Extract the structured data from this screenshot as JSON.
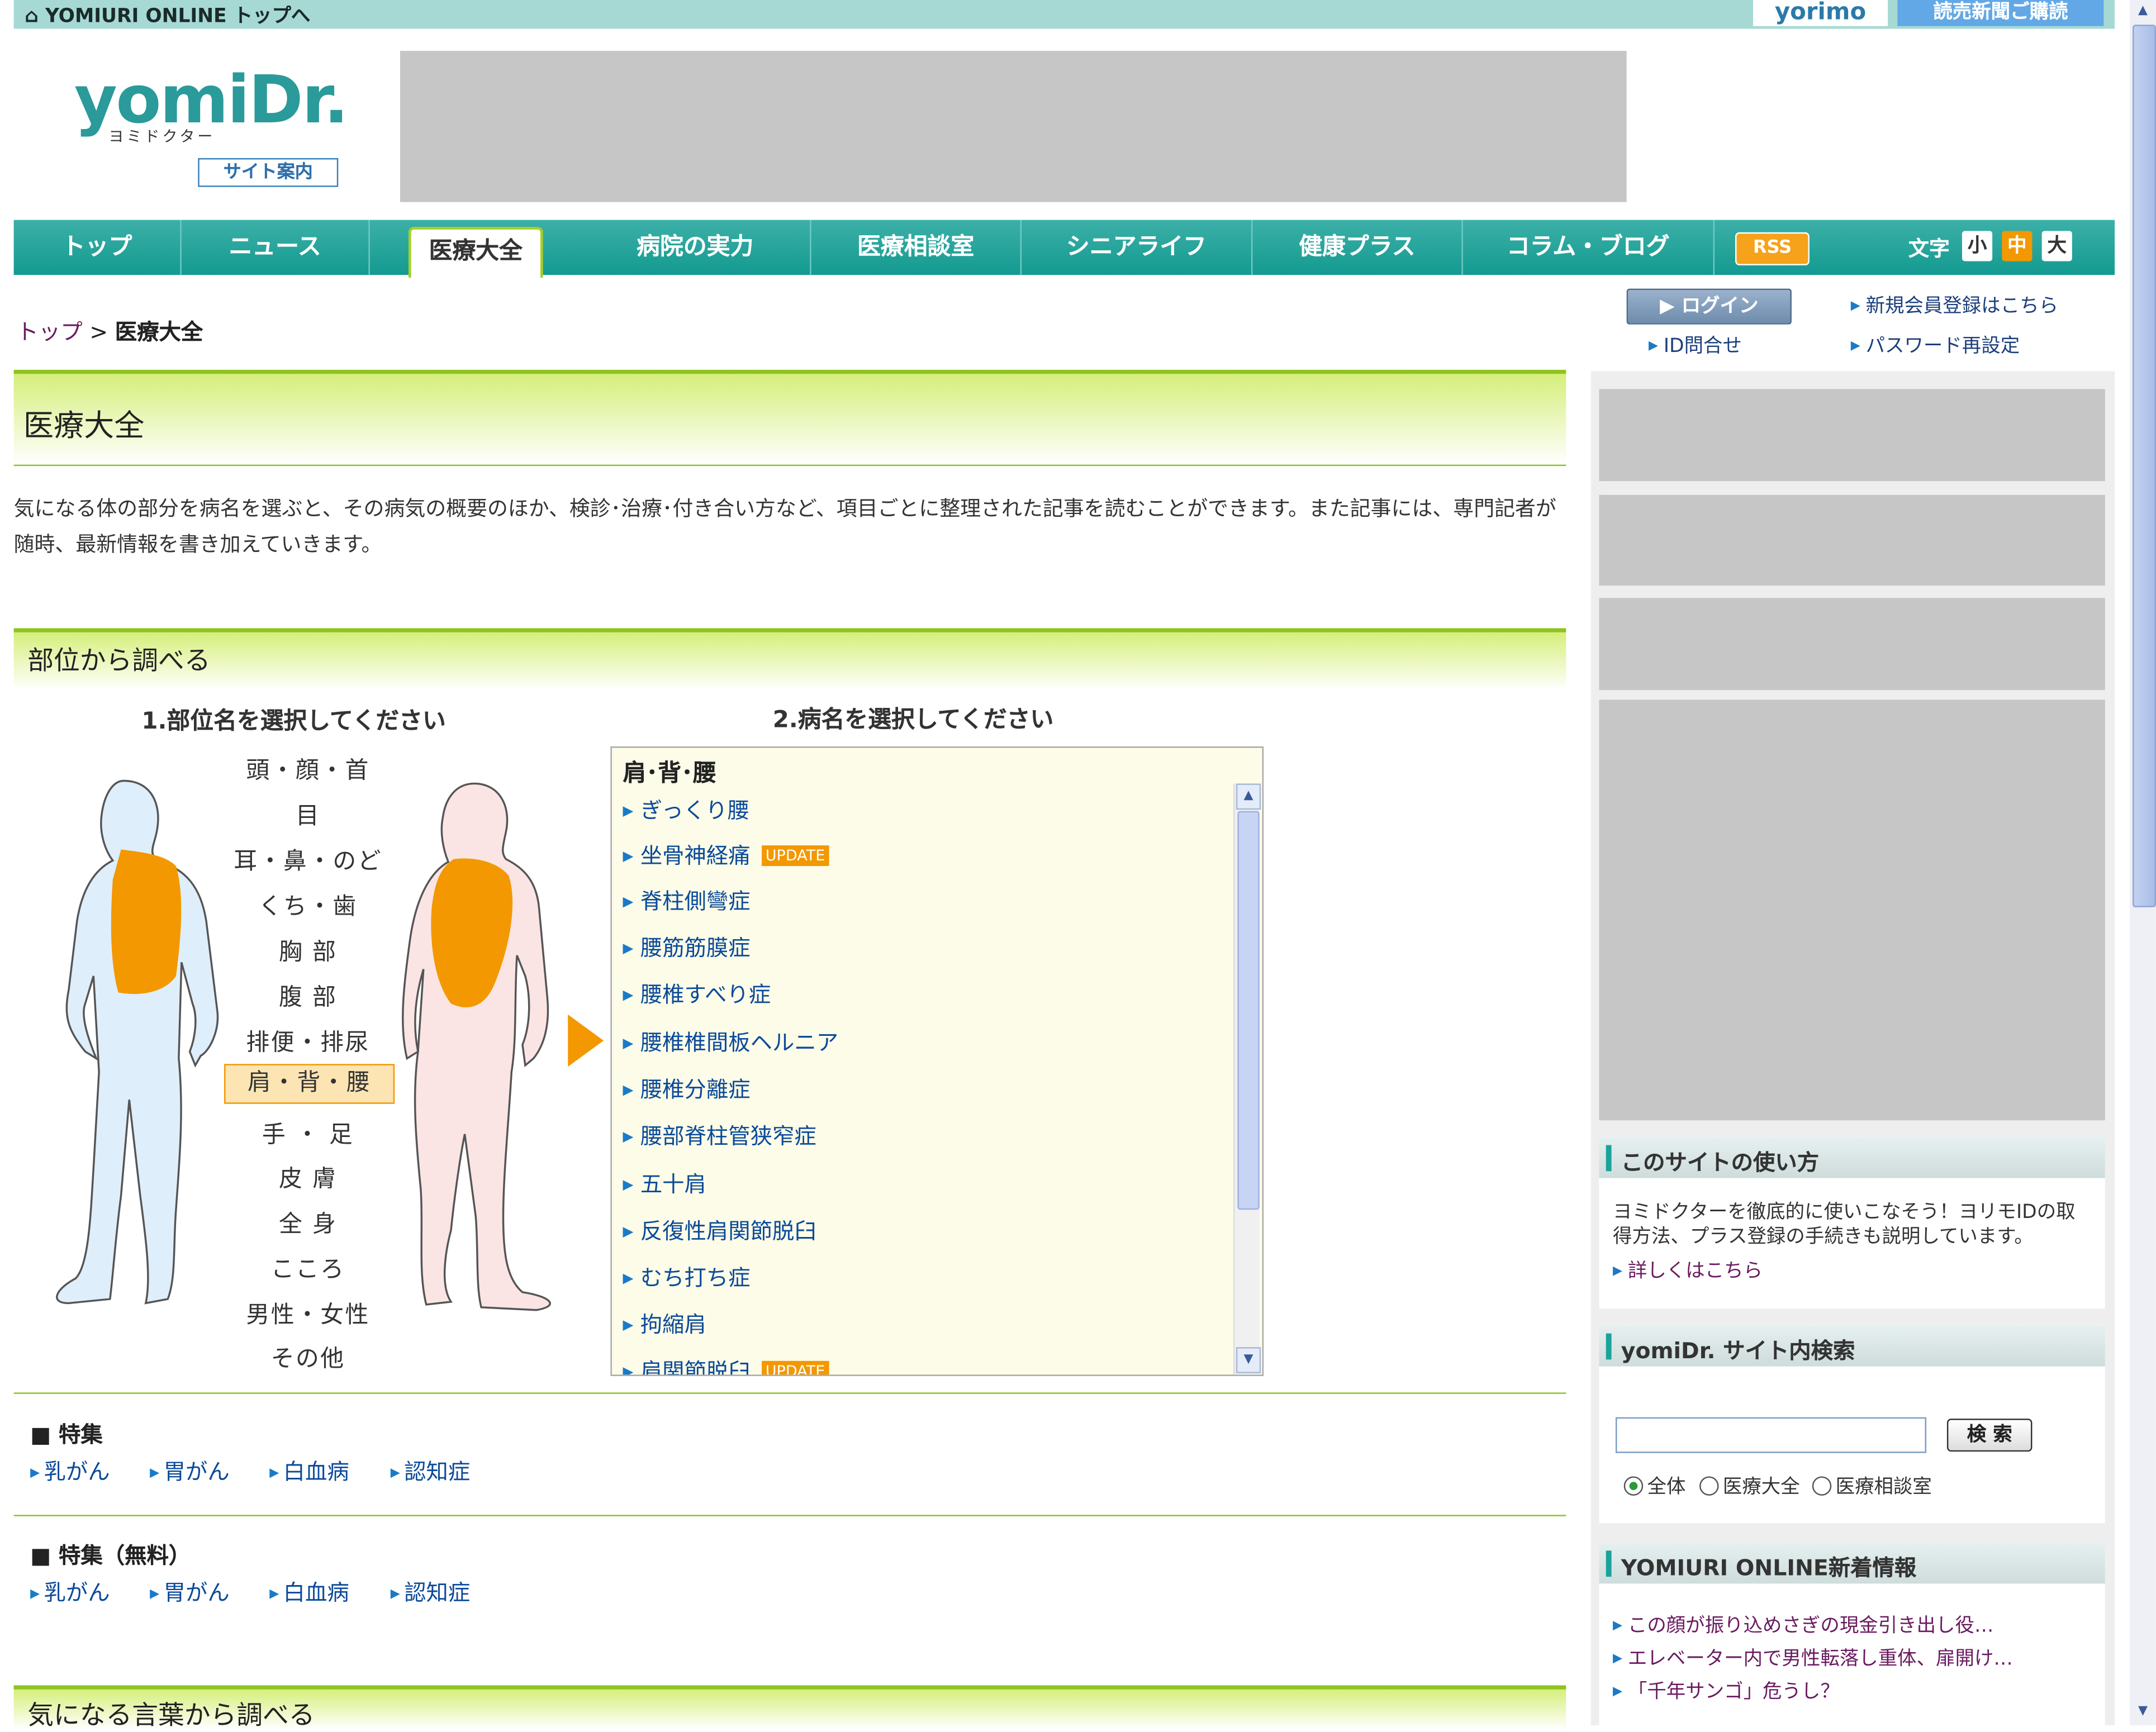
{
  "topbar": {
    "home_link": "YOMIURI ONLINE トップへ",
    "yorimo": "yorimo",
    "subscribe": "読売新聞ご購読"
  },
  "header": {
    "logo": "yomiDr.",
    "logo_kana": "ヨミドクター",
    "site_guide": "サイト案内"
  },
  "nav": {
    "items": [
      "トップ",
      "ニュース",
      "医療大全",
      "病院の実力",
      "医療相談室",
      "シニアライフ",
      "健康プラス",
      "コラム・ブログ"
    ],
    "rss": "RSS",
    "font_label": "文字",
    "font_sizes": [
      "小",
      "中",
      "大"
    ]
  },
  "breadcrumb": {
    "top": "トップ",
    "sep": ">",
    "current": "医療大全"
  },
  "account": {
    "login": "ログイン",
    "register": "新規会員登録はこちら",
    "id_inquiry": "ID問合せ",
    "password_reset": "パスワード再設定"
  },
  "main": {
    "title": "医療大全",
    "intro": "気になる体の部分を病名を選ぶと、その病気の概要のほか、検診･治療･付き合い方など、項目ごとに整理された記事を読むことができます。また記事には、専門記者が随時、最新情報を書き加えていきます。"
  },
  "body_section": {
    "title": "部位から調べる",
    "step1": "1.部位名を選択してください",
    "step2": "2.病名を選択してください",
    "parts": [
      "頭・顔・首",
      "目",
      "耳・鼻・のど",
      "くち・歯",
      "胸 部",
      "腹 部",
      "排便・排尿",
      "肩・背・腰",
      "手 ・ 足",
      "皮 膚",
      "全 身",
      "こころ",
      "男性・女性",
      "その他"
    ],
    "selected_part": "肩・背・腰",
    "list_title": "肩･背･腰",
    "update_badge": "UPDATE",
    "diseases": [
      "ぎっくり腰",
      "坐骨神経痛",
      "脊柱側彎症",
      "腰筋筋膜症",
      "腰椎すべり症",
      "腰椎椎間板ヘルニア",
      "腰椎分離症",
      "腰部脊柱管狭窄症",
      "五十肩",
      "反復性肩関節脱臼",
      "むち打ち症",
      "拘縮肩",
      "肩関節脱臼"
    ]
  },
  "features": {
    "title": "■ 特集",
    "links": [
      "乳がん",
      "胃がん",
      "白血病",
      "認知症"
    ]
  },
  "features_free": {
    "title": "■ 特集（無料）",
    "links": [
      "乳がん",
      "胃がん",
      "白血病",
      "認知症"
    ]
  },
  "keyword_section": {
    "title": "気になる言葉から調べる"
  },
  "sidebar": {
    "howto": {
      "title": "このサイトの使い方",
      "text": "ヨミドクターを徹底的に使いこなそう！ヨリモIDの取得方法、プラス登録の手続きも説明しています。",
      "link": "詳しくはこちら"
    },
    "search": {
      "title": "yomiDr. サイト内検索",
      "button": "検 索",
      "options": [
        "全体",
        "医療大全",
        "医療相談室"
      ]
    },
    "news": {
      "title": "YOMIURI ONLINE新着情報",
      "items": [
        "この顔が振り込めさぎの現金引き出し役…",
        "エレベーター内で男性転落し重体、扉開け…",
        "「千年サンゴ」危うし？"
      ]
    }
  }
}
